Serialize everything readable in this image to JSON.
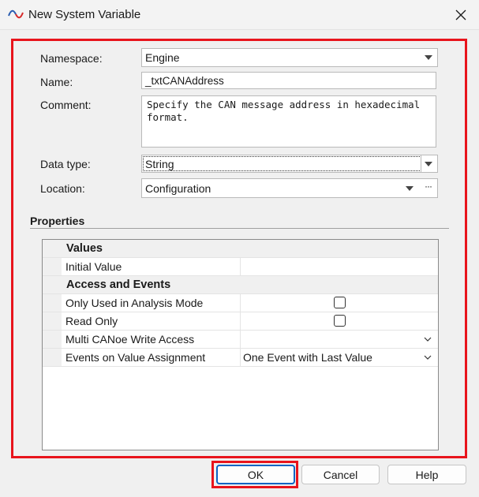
{
  "window": {
    "title": "New System Variable",
    "icon": "signal-wave-icon",
    "close_icon": "close-icon"
  },
  "form": {
    "namespace_label": "Namespace:",
    "namespace_value": "Engine",
    "name_label": "Name:",
    "name_value": "_txtCANAddress",
    "comment_label": "Comment:",
    "comment_value": "Specify the CAN message address in hexadecimal\nformat.",
    "datatype_label": "Data type:",
    "datatype_value": "String",
    "location_label": "Location:",
    "location_value": "Configuration",
    "location_browse": "···"
  },
  "properties": {
    "title": "Properties",
    "categories": [
      {
        "name": "Values",
        "items": [
          {
            "name": "Initial Value",
            "value": ""
          }
        ]
      },
      {
        "name": "Access and Events",
        "items": [
          {
            "name": "Only Used in Analysis Mode",
            "type": "checkbox",
            "checked": false
          },
          {
            "name": "Read Only",
            "type": "checkbox",
            "checked": false
          },
          {
            "name": "Multi CANoe Write Access",
            "type": "dropdown",
            "value": ""
          },
          {
            "name": "Events on Value Assignment",
            "type": "dropdown",
            "value": "One Event with Last Value"
          }
        ]
      }
    ]
  },
  "buttons": {
    "ok": "OK",
    "cancel": "Cancel",
    "help": "Help"
  },
  "colors": {
    "highlight": "#e8141c",
    "default_button_border": "#0a64c4",
    "icon_red": "#d62a2a",
    "icon_blue": "#2a5db0"
  }
}
